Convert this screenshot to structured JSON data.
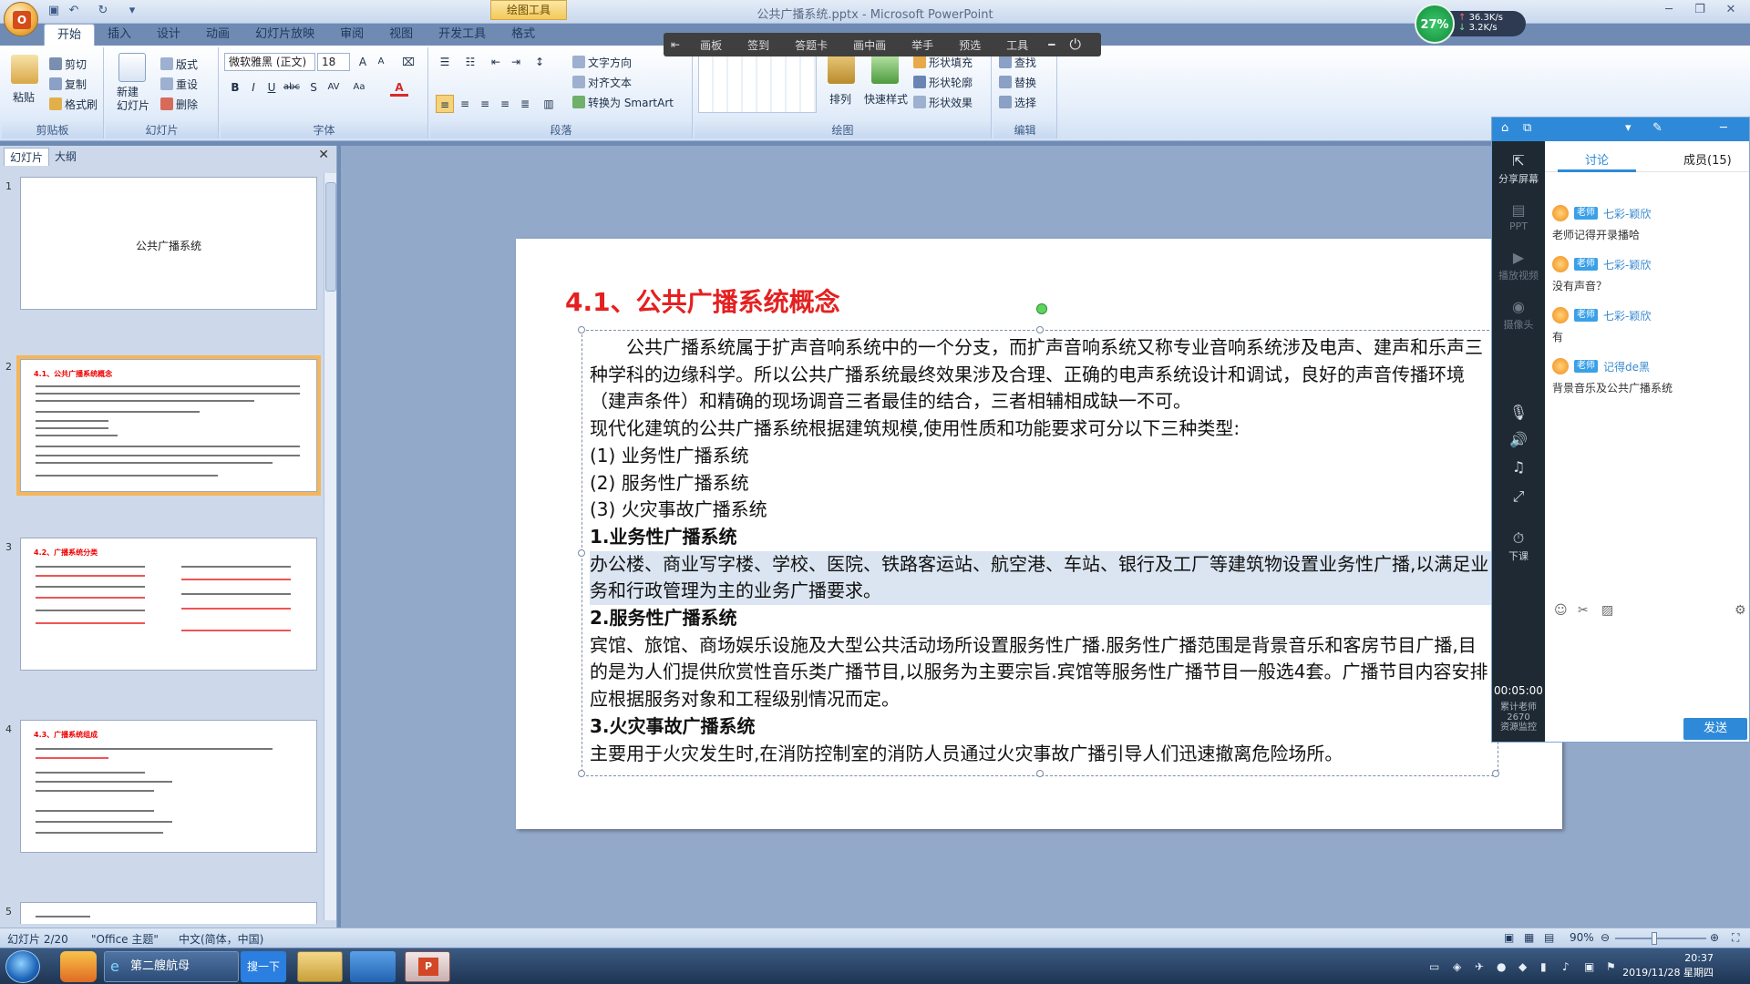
{
  "window": {
    "title": "公共广播系统.pptx - Microsoft PowerPoint",
    "contextual_tab": "绘图工具"
  },
  "ribbon_tabs": [
    "开始",
    "插入",
    "设计",
    "动画",
    "幻灯片放映",
    "审阅",
    "视图",
    "开发工具",
    "格式"
  ],
  "ribbon": {
    "clipboard": {
      "paste": "粘贴",
      "cut": "剪切",
      "copy": "复制",
      "format_painter": "格式刷",
      "label": "剪贴板"
    },
    "slides": {
      "new_slide": "新建\n幻灯片",
      "layout": "版式",
      "reset": "重设",
      "delete": "删除",
      "label": "幻灯片"
    },
    "font": {
      "font_name": "微软雅黑 (正文)",
      "font_size": "18",
      "label": "字体"
    },
    "paragraph": {
      "text_direction": "文字方向",
      "align_text": "对齐文本",
      "smartart": "转换为 SmartArt",
      "label": "段落"
    },
    "drawing": {
      "arrange": "排列",
      "quick_styles": "快速样式",
      "shape_fill": "形状填充",
      "shape_outline": "形状轮廓",
      "shape_effects": "形状效果",
      "label": "绘图"
    },
    "editing": {
      "find": "查找",
      "replace": "替换",
      "select": "选择",
      "label": "编辑"
    }
  },
  "float_toolbar": [
    "画板",
    "签到",
    "答题卡",
    "画中画",
    "举手",
    "预选",
    "工具"
  ],
  "net_widget": {
    "percent": "27%",
    "up": "36.3K/s",
    "down": "3.2K/s"
  },
  "slide_panel": {
    "tabs": [
      "幻灯片",
      "大纲"
    ],
    "thumbs": [
      {
        "num": "1",
        "title": "公共广播系统"
      },
      {
        "num": "2",
        "title": "4.1、公共广播系统概念"
      },
      {
        "num": "3",
        "title": "4.2、广播系统分类"
      },
      {
        "num": "4",
        "title": "4.3、广播系统组成"
      },
      {
        "num": "5",
        "title": ""
      }
    ]
  },
  "slide": {
    "title": "4.1、公共广播系统概念",
    "paragraphs": [
      {
        "text": "公共广播系统属于扩声音响系统中的一个分支，而扩声音响系统又称专业音响系统涉及电声、建声和乐声三种学科的边缘科学。所以公共广播系统最终效果涉及合理、正确的电声系统设计和调试，良好的声音传播环境（建声条件）和精确的现场调音三者最佳的结合，三者相辅相成缺一不可。",
        "style": "indent"
      },
      {
        "text": "现代化建筑的公共广播系统根据建筑规模,使用性质和功能要求可分以下三种类型:",
        "style": ""
      },
      {
        "text": "(1) 业务性广播系统",
        "style": ""
      },
      {
        "text": "(2) 服务性广播系统",
        "style": ""
      },
      {
        "text": "(3) 火灾事故广播系统",
        "style": ""
      },
      {
        "text": "1.业务性广播系统",
        "style": "h"
      },
      {
        "text": "办公楼、商业写字楼、学校、医院、铁路客运站、航空港、车站、银行及工厂等建筑物设置业务性广播,以满足业务和行政管理为主的业务广播要求。",
        "style": "hl"
      },
      {
        "text": "2.服务性广播系统",
        "style": "h"
      },
      {
        "text": "宾馆、旅馆、商场娱乐设施及大型公共活动场所设置服务性广播.服务性广播范围是背景音乐和客房节目广播,目的是为人们提供欣赏性音乐类广播节目,以服务为主要宗旨.宾馆等服务性广播节目一般选4套。广播节目内容安排应根据服务对象和工程级别情况而定。",
        "style": ""
      },
      {
        "text": "3.火灾事故广播系统",
        "style": "h"
      },
      {
        "text": "主要用于火灾发生时,在消防控制室的消防人员通过火灾事故广播引导人们迅速撤离危险场所。",
        "style": ""
      }
    ]
  },
  "class_panel": {
    "side": {
      "share": "分享屏幕",
      "ppt": "PPT",
      "video": "播放视频",
      "camera": "摄像头",
      "end": "下课",
      "timer": "00:05:00",
      "stats": "累计老师\n2670\n资源监控"
    },
    "tabs": {
      "discussion": "讨论",
      "members": "成员(15)"
    },
    "messages": [
      {
        "badge": "老师",
        "name": "七彩-颖欣",
        "text": "老师记得开录播哈"
      },
      {
        "badge": "老师",
        "name": "七彩-颖欣",
        "text": "没有声音？"
      },
      {
        "badge": "老师",
        "name": "七彩-颖欣",
        "text": "有"
      },
      {
        "badge": "老师",
        "name": "记得de黑",
        "text": "背景音乐及公共广播系统"
      }
    ],
    "send": "发送"
  },
  "statusbar": {
    "slide": "幻灯片 2/20",
    "theme": "\"Office 主题\"",
    "language": "中文(简体，中国)",
    "zoom": "90%"
  },
  "taskbar": {
    "browser": "第二艘航母",
    "search": "搜一下",
    "time": "20:37",
    "date": "2019/11/28 星期四"
  },
  "colors": {
    "title_red": "#e52020",
    "accent_blue": "#2e8ad8"
  }
}
